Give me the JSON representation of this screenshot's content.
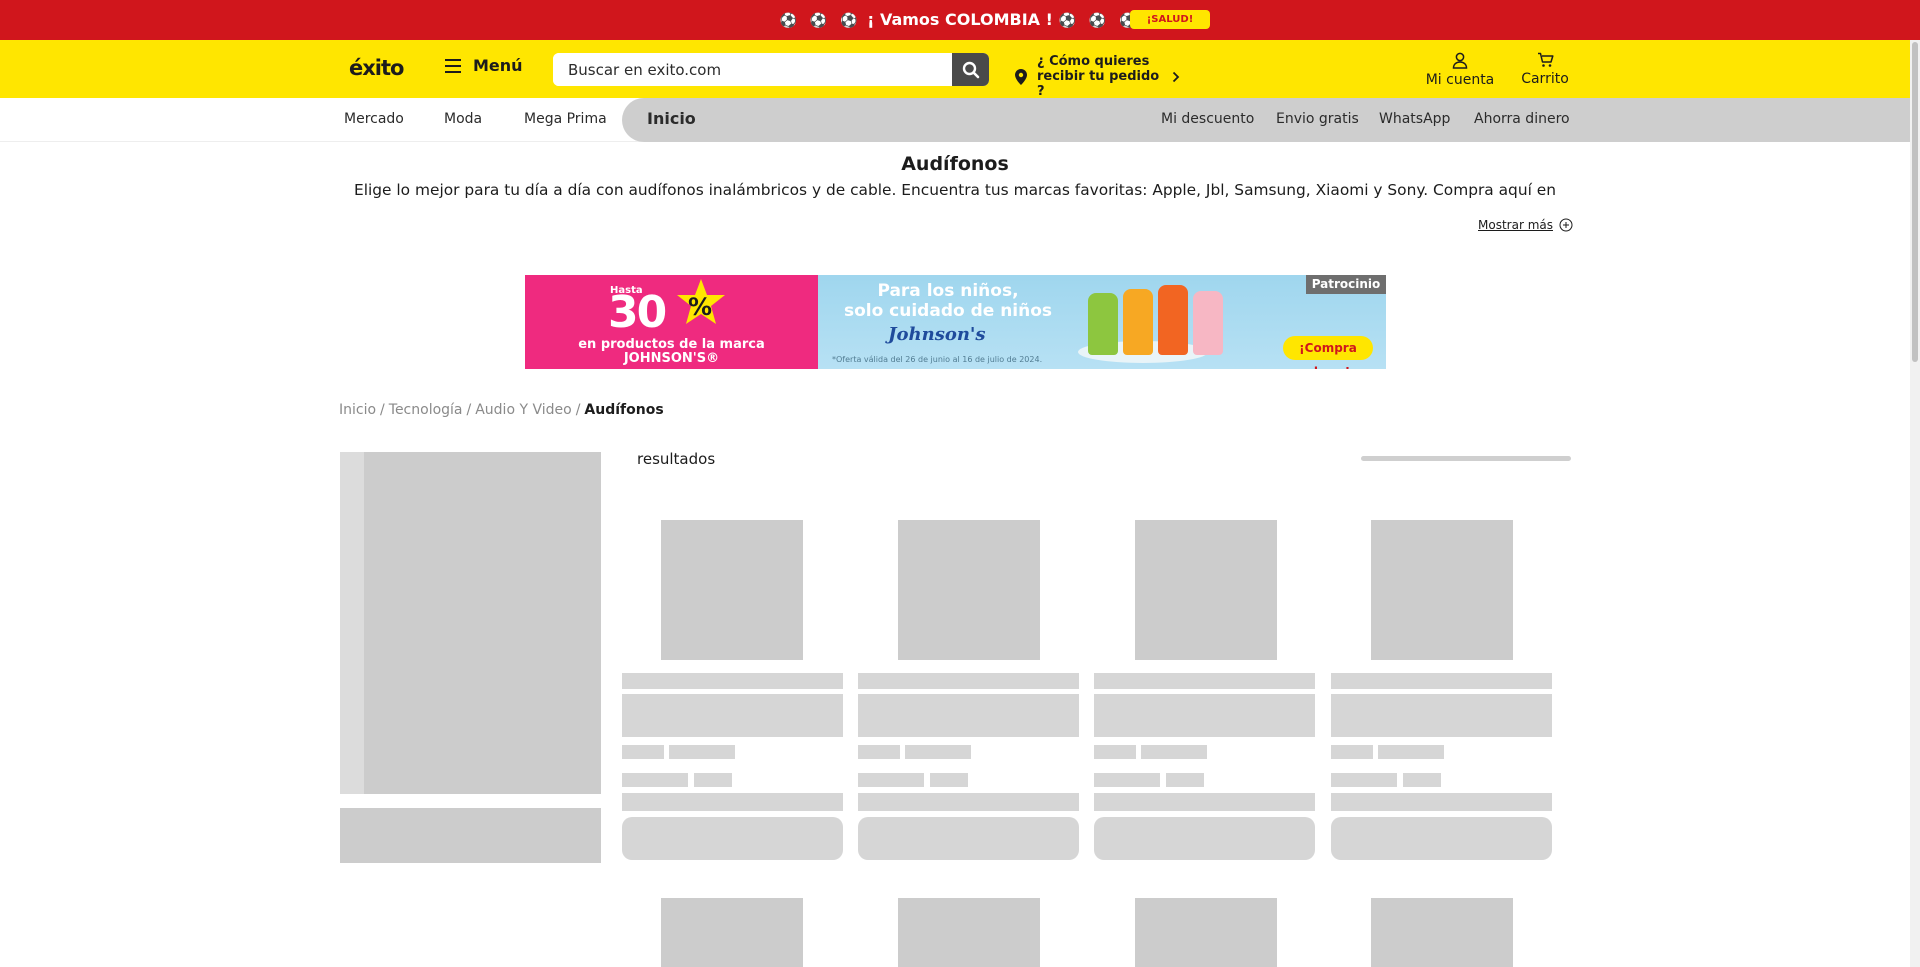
{
  "promo": {
    "balls_left": "⚽ ⚽ ⚽",
    "message": "¡ Vamos COLOMBIA !",
    "balls_right": "⚽ ⚽ ⚽",
    "badge": "¡SALUD!"
  },
  "header": {
    "logo": "éxito",
    "menu_label": "Menú",
    "search_placeholder": "Buscar en exito.com",
    "delivery_line1": "¿ Cómo quieres",
    "delivery_line2": "recibir tu pedido ?",
    "account_label": "Mi cuenta",
    "cart_label": "Carrito"
  },
  "nav": {
    "left_items": [
      "Mercado",
      "Moda",
      "Mega Prima"
    ],
    "active_item": "Inicio",
    "right_items": [
      "Mi descuento",
      "Envio gratis",
      "WhatsApp",
      "Ahorra dinero"
    ]
  },
  "category": {
    "title": "Audífonos",
    "description": "Elige lo mejor para tu día a día con audífonos inalámbricos y de cable. Encuentra tus marcas favoritas: Apple, Jbl, Samsung, Xiaomi y Sony. Compra aquí en",
    "show_more": "Mostrar más"
  },
  "banner": {
    "hasta": "Hasta",
    "discount": "30",
    "percent": "%",
    "line1": "en productos de la marca",
    "line2": "JOHNSON'S®",
    "headline1": "Para los niños,",
    "headline2": "solo cuidado de niños",
    "brand": "Johnson's",
    "note": "*Oferta válida del 26 de junio al 16 de julio de 2024.",
    "cta": "¡Compra ahora!",
    "sponsor": "Patrocinio"
  },
  "breadcrumb": {
    "items": [
      "Inicio",
      "Tecnología",
      "Audio Y Video"
    ],
    "separator": "/",
    "current": "Audífonos"
  },
  "results": {
    "label": "resultados"
  },
  "colors": {
    "promo_red": "#d0161c",
    "brand_yellow": "#ffe600",
    "skeleton_gray": "#cccccc",
    "nav_gray": "#cecece"
  }
}
